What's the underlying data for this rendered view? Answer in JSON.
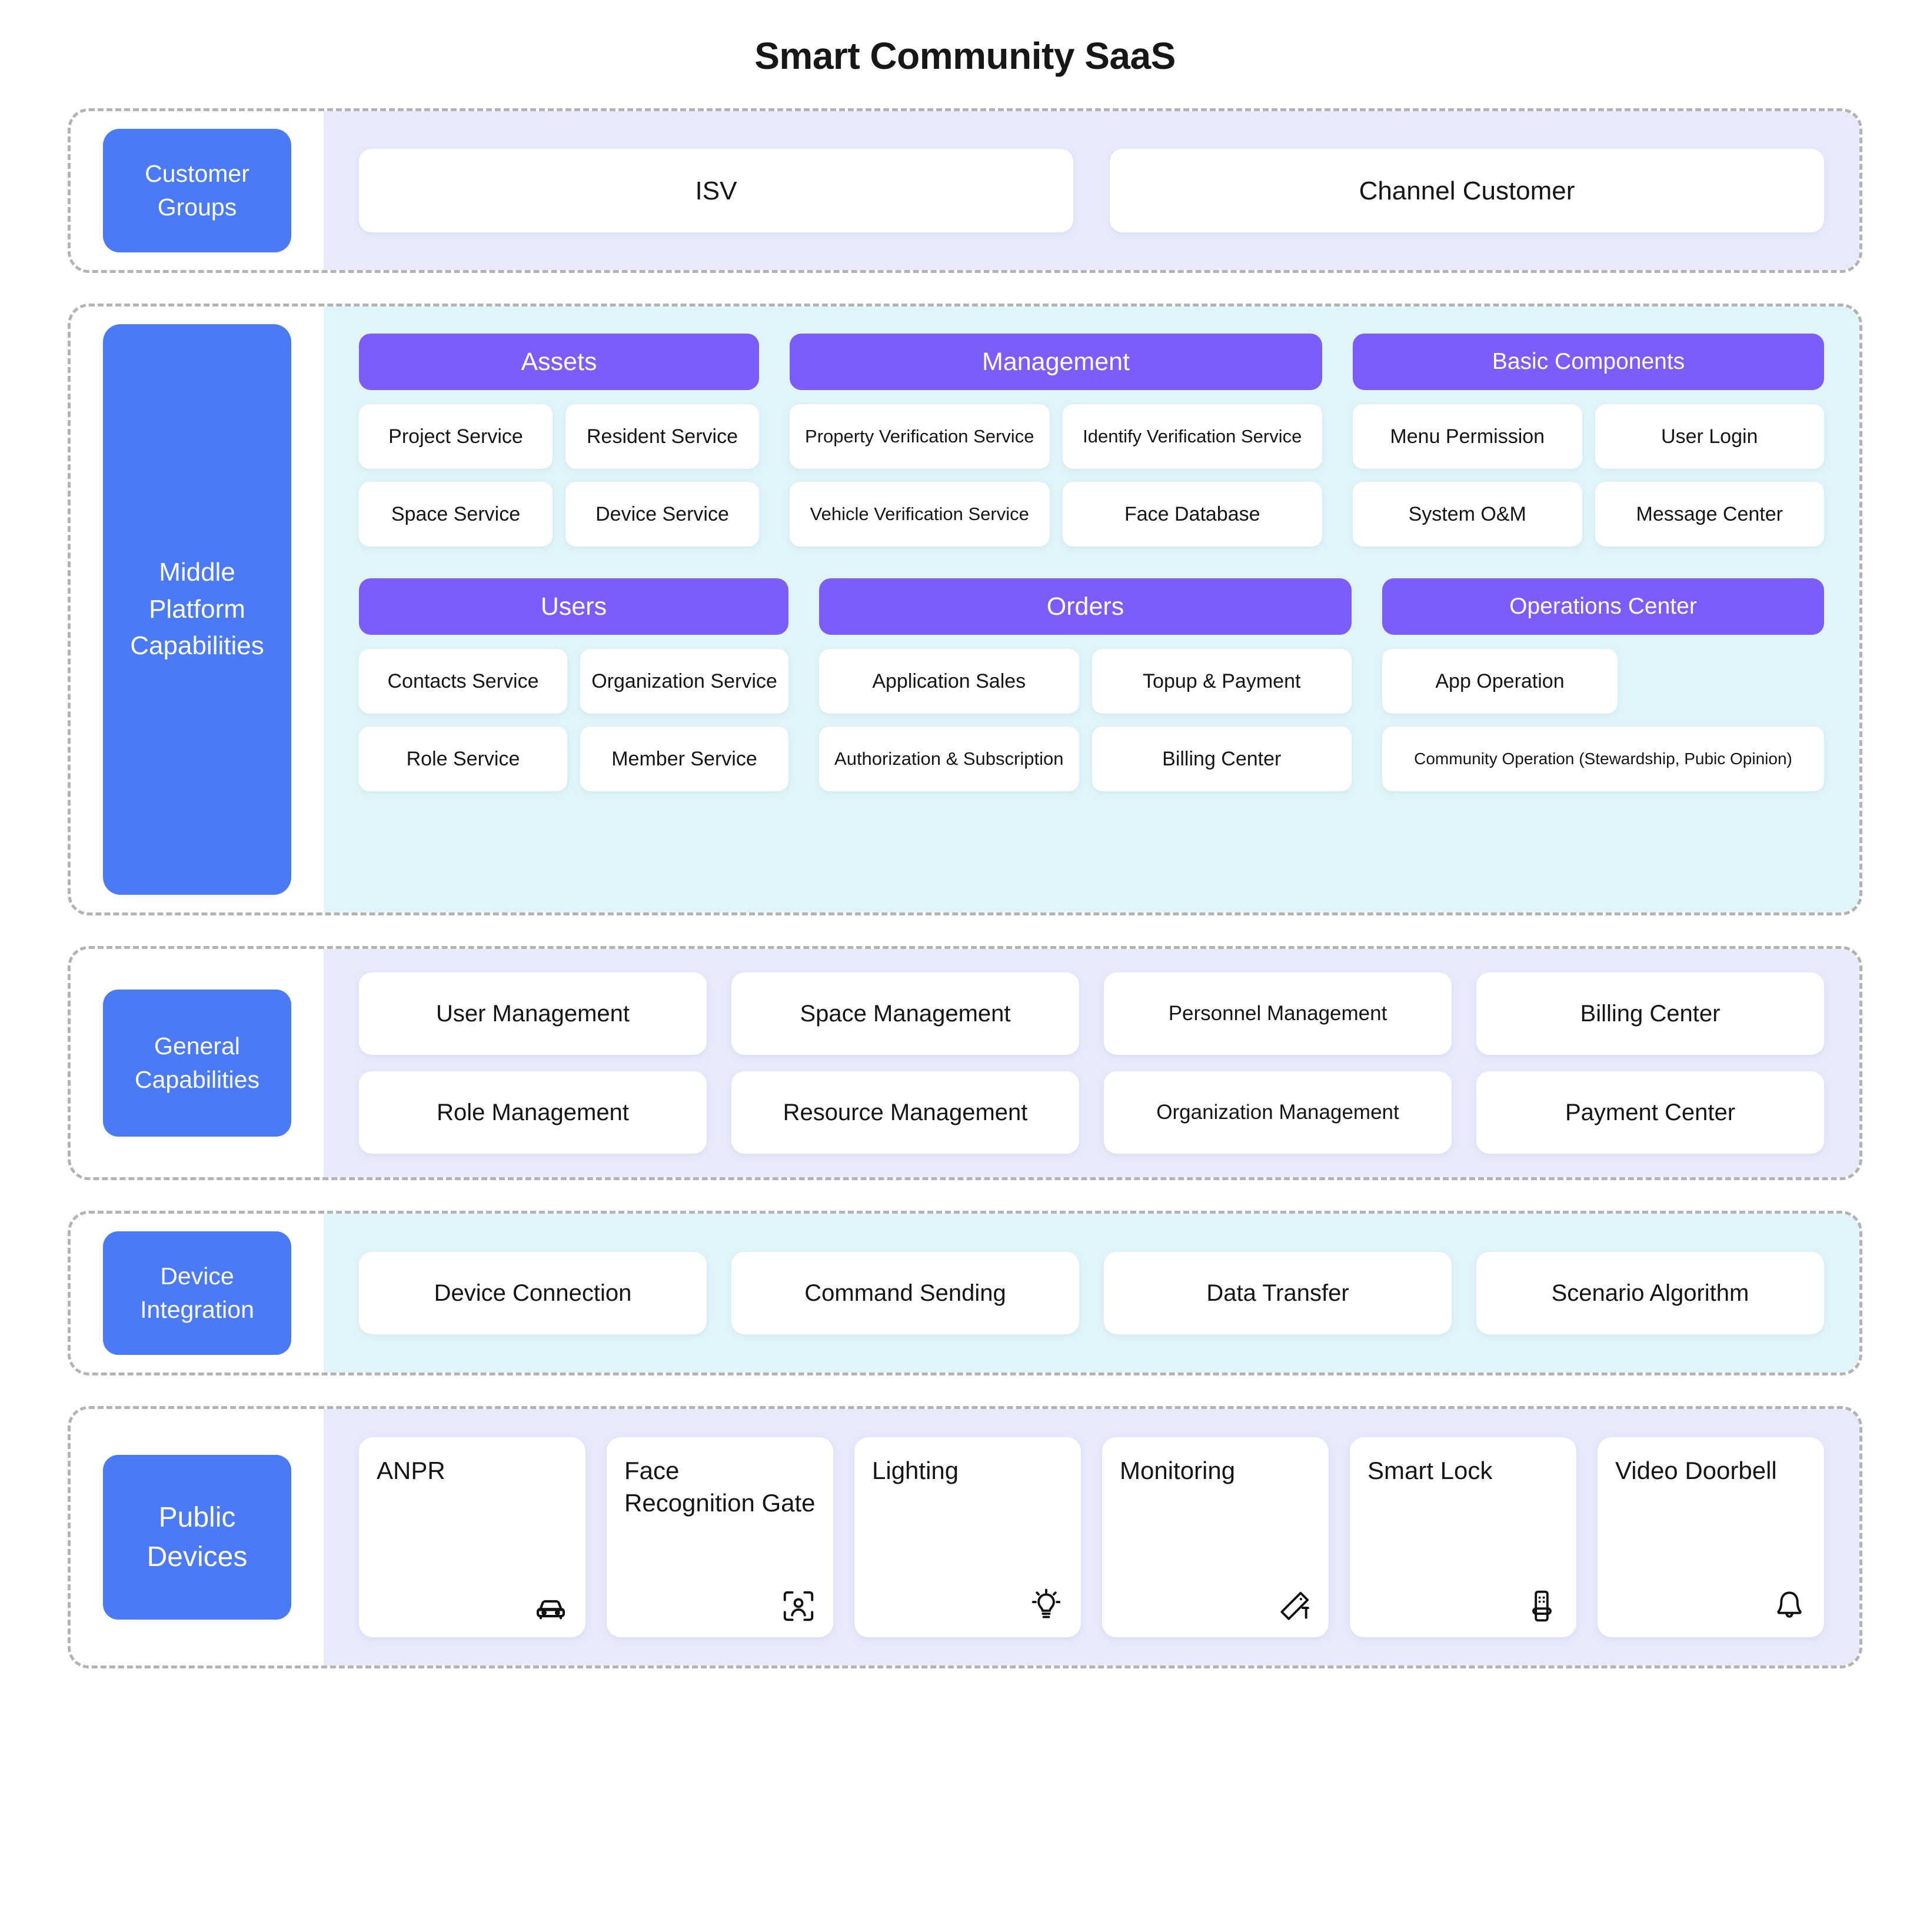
{
  "title": "Smart Community SaaS",
  "colors": {
    "label_blue": "#4a7af5",
    "header_purple": "#7c5cfa",
    "tint_lavender": "#e8eafc",
    "tint_cyan": "#e0f5fb",
    "dashed_border": "#b3b3b3"
  },
  "customer_groups": {
    "label": "Customer\nGroups",
    "label_line1": "Customer",
    "label_line2": "Groups",
    "items": [
      "ISV",
      "Channel Customer"
    ]
  },
  "middle_platform": {
    "label_line1": "Middle",
    "label_line2": "Platform",
    "label_line3": "Capabilities",
    "groups": [
      {
        "header": "Assets",
        "items": [
          "Project Service",
          "Resident Service",
          "Space Service",
          "Device Service"
        ]
      },
      {
        "header": "Management",
        "items": [
          "Property Verification Service",
          "Identify Verification Service",
          "Vehicle Verification Service",
          "Face Database"
        ]
      },
      {
        "header": "Basic Components",
        "items": [
          "Menu Permission",
          "User Login",
          "System O&M",
          "Message Center"
        ]
      },
      {
        "header": "Users",
        "items": [
          "Contacts Service",
          "Organization Service",
          "Role Service",
          "Member Service"
        ]
      },
      {
        "header": "Orders",
        "items": [
          "Application Sales",
          "Topup & Payment",
          "Authorization & Subscription",
          "Billing Center"
        ]
      },
      {
        "header": "Operations Center",
        "items": [
          "App Operation",
          "Community Operation (Stewardship, Pubic Opinion)"
        ]
      }
    ]
  },
  "general_capabilities": {
    "label_line1": "General",
    "label_line2": "Capabilities",
    "items": [
      "User Management",
      "Space Management",
      "Personnel Management",
      "Billing Center",
      "Role Management",
      "Resource Management",
      "Organization Management",
      "Payment Center"
    ]
  },
  "device_integration": {
    "label_line1": "Device",
    "label_line2": "Integration",
    "items": [
      "Device Connection",
      "Command Sending",
      "Data Transfer",
      "Scenario Algorithm"
    ]
  },
  "public_devices": {
    "label_line1": "Public",
    "label_line2": "Devices",
    "items": [
      {
        "label": "ANPR",
        "icon": "car-icon"
      },
      {
        "label": "Face Recognition Gate",
        "icon": "face-scan-icon"
      },
      {
        "label": "Lighting",
        "icon": "lightbulb-icon"
      },
      {
        "label": "Monitoring",
        "icon": "cctv-camera-icon"
      },
      {
        "label": "Smart Lock",
        "icon": "smart-lock-icon"
      },
      {
        "label": "Video Doorbell",
        "icon": "bell-icon"
      }
    ]
  }
}
